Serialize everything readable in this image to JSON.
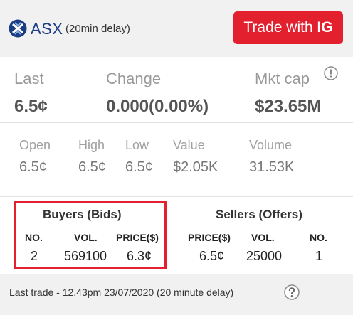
{
  "header": {
    "exchange_name": "ASX",
    "delay_note": "(20min delay)",
    "trade_button": {
      "prefix": "Trade with ",
      "brand": "IG"
    },
    "colors": {
      "brand_red": "#e2202e",
      "asx_blue": "#1b3d84"
    }
  },
  "summary": {
    "last": {
      "label": "Last",
      "value": "6.5¢"
    },
    "change": {
      "label": "Change",
      "value": "0.000(0.00%)"
    },
    "mkt_cap": {
      "label": "Mkt cap",
      "value": "$23.65M"
    },
    "info_icon": "info-icon"
  },
  "details": {
    "open": {
      "label": "Open",
      "value": "6.5¢"
    },
    "high": {
      "label": "High",
      "value": "6.5¢"
    },
    "low": {
      "label": "Low",
      "value": "6.5¢"
    },
    "value": {
      "label": "Value",
      "value": "$2.05K"
    },
    "volume": {
      "label": "Volume",
      "value": "31.53K"
    }
  },
  "buyers": {
    "title": "Buyers (Bids)",
    "headers": {
      "no": "NO.",
      "vol": "VOL.",
      "price": "PRICE($)"
    },
    "row": {
      "no": "2",
      "vol": "569100",
      "price": "6.3¢"
    }
  },
  "sellers": {
    "title": "Sellers (Offers)",
    "headers": {
      "price": "PRICE($)",
      "vol": "VOL.",
      "no": "NO."
    },
    "row": {
      "price": "6.5¢",
      "vol": "25000",
      "no": "1"
    }
  },
  "footer": {
    "last_trade": "Last trade - 12.43pm 23/07/2020 (20 minute delay)",
    "help_icon": "question-icon"
  }
}
